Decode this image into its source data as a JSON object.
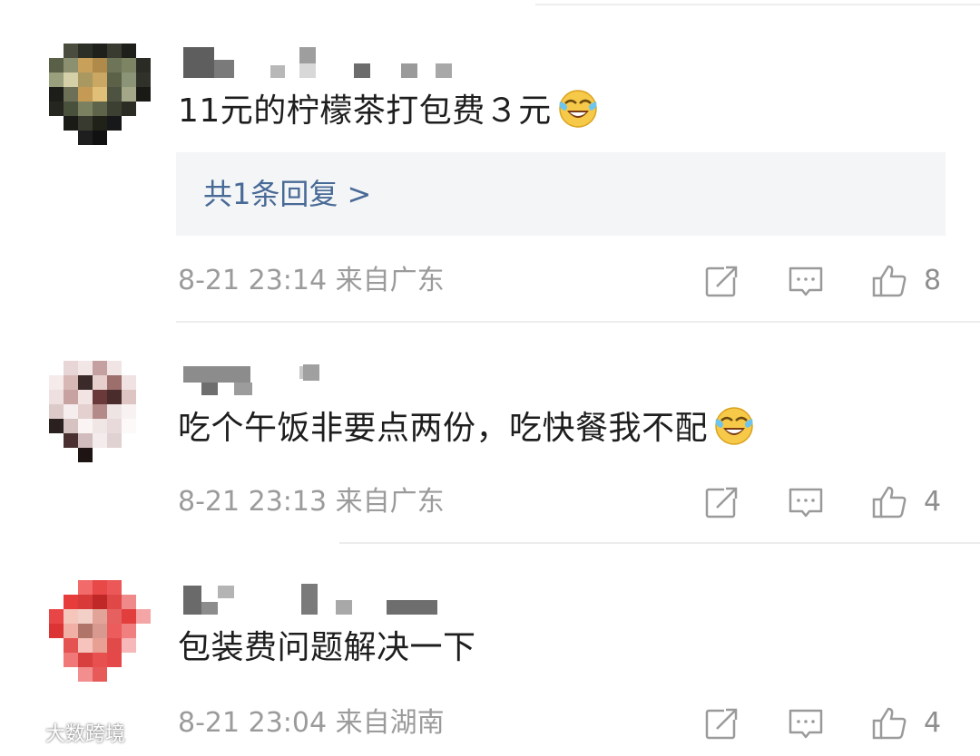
{
  "colors": {
    "link": "#486a96",
    "meta": "#9b9b9b",
    "reply_box_bg": "#f4f5f7",
    "divider": "#ededed"
  },
  "comments": [
    {
      "text": "11元的柠檬茶打包费３元",
      "emoji": "laughing-crying-emoji",
      "reply_link": "共1条回复 >",
      "meta": "8-21 23:14 来自广东",
      "likes": "8"
    },
    {
      "text": "吃个午饭非要点两份，吃快餐我不配",
      "emoji": "laughing-crying-emoji",
      "meta": "8-21 23:13 来自广东",
      "likes": "4"
    },
    {
      "text": "包装费问题解决一下",
      "meta": "8-21 23:04 来自湖南",
      "likes": "4"
    }
  ],
  "icons": {
    "share": "share-icon",
    "reply": "comment-icon",
    "like": "thumbs-up-icon"
  },
  "watermark": {
    "text": "大数跨境"
  }
}
